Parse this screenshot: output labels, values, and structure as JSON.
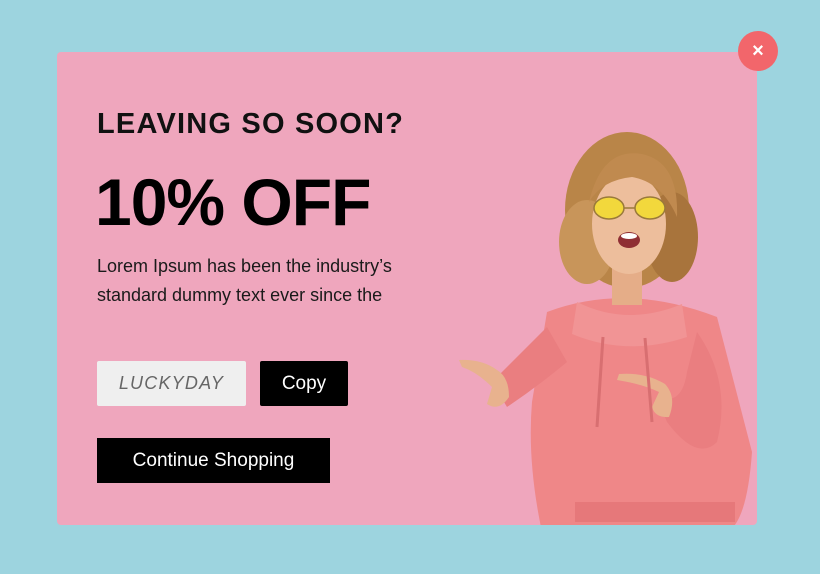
{
  "popup": {
    "eyebrow": "LEAVING SO SOON?",
    "headline": "10% OFF",
    "description": "Lorem Ipsum has been the industry’s standard dummy text ever since the",
    "coupon_code": "LUCKYDAY",
    "copy_label": "Copy",
    "continue_label": "Continue Shopping",
    "close_icon": "×"
  },
  "colors": {
    "page_background": "#9dd4df",
    "modal_background": "#efa6bd",
    "close_button": "#f2666b",
    "button": "#000000",
    "coupon_field": "#efefef"
  },
  "icons": {
    "close": "close-icon"
  }
}
